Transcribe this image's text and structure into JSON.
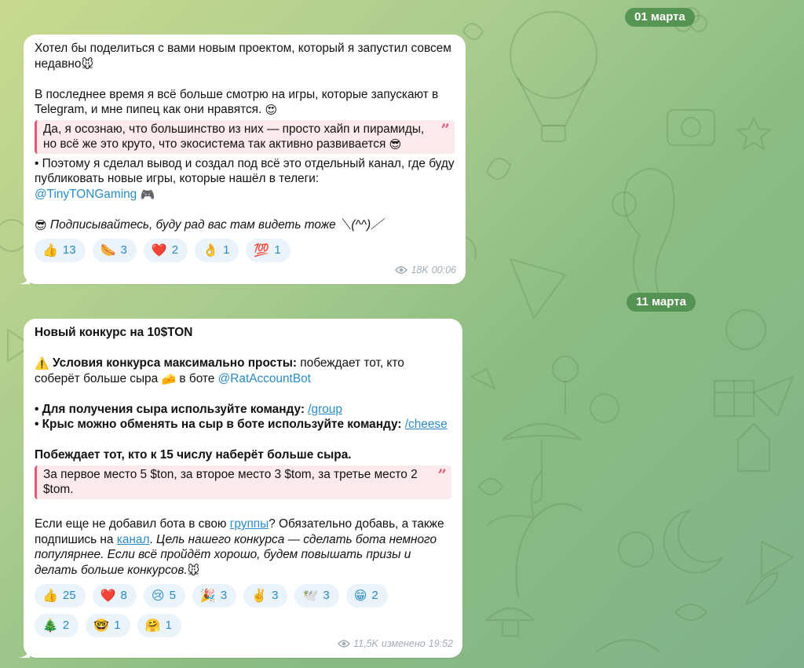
{
  "dates": [
    "01 марта",
    "11 марта"
  ],
  "post1": {
    "p1": "Хотел бы поделиться с вами новым проектом, который я запустил совсем недавно",
    "p1_emoji": "🐭",
    "p2": "В последнее время я всё больше смотрю на игры, которые запускают в Telegram, и мне пипец как они нравятся.",
    "p2_emoji": "😍",
    "quote": "Да, я осознаю, что большинство из них — просто хайп и пирамиды, но всё же это круто, что экосистема так активно развивается",
    "quote_emoji": "😎",
    "quote_mark": "”",
    "p3": "• Поэтому я сделал вывод и создал под всё это отдельный канал, где буду публиковать новые игры, которые нашёл в телеги:",
    "channel_link": "@TinyTONGaming",
    "channel_emoji": "🎮",
    "closing_emoji": "😎",
    "closing": "Подписывайтесь, буду рад вас там видеть тоже ＼(^^)／",
    "reactions": [
      {
        "emoji": "👍",
        "count": "13",
        "icon": "thumbs-up"
      },
      {
        "emoji": "🌭",
        "count": "3",
        "icon": "hotdog"
      },
      {
        "emoji": "❤️",
        "count": "2",
        "icon": "heart"
      },
      {
        "emoji": "👌",
        "count": "1",
        "icon": "ok-hand"
      },
      {
        "emoji": "💯",
        "count": "1",
        "icon": "hundred"
      }
    ],
    "views": "18K",
    "time": "00:06"
  },
  "post2": {
    "title": "Новый конкурс на 10$TON",
    "warn_emoji": "⚠️",
    "conditions_bold": "Условия конкурса максимально просты:",
    "conditions_text": "побеждает тот, кто соберёт больше сыра",
    "cheese_emoji": "🧀",
    "in_bot": "в боте",
    "bot_link": "@RatAccountBot",
    "rule1_bold": "• Для получения сыра используйте команду:",
    "rule1_cmd": "/group",
    "rule2_bold": "• Крыс можно обменять на сыр в боте используйте команду:",
    "rule2_cmd": "/cheese",
    "winner_bold": "Побеждает тот, кто к 15 числу наберёт больше сыра.",
    "prizes_quote": "За первое место 5 $ton, за второе место 3 $tom, за третье место 2 $tom.",
    "quote_mark": "”",
    "p_end_1": "Если еще не добавил бота в свою",
    "groups_link": "группы",
    "p_end_2": "? Обязательно добавь, а также подпишись на",
    "channel_link": "канал",
    "p_end_3": ".",
    "italic_tail": "Цель нашего конкурса — сделать бота немного популярнее. Если всё пройдёт хорошо, будем повышать призы и делать больше конкурсов.",
    "end_emoji": "🐭",
    "reactions": [
      {
        "emoji": "👍",
        "count": "25",
        "icon": "thumbs-up"
      },
      {
        "emoji": "❤️",
        "count": "8",
        "icon": "heart"
      },
      {
        "emoji": "😢",
        "count": "5",
        "icon": "crying-face"
      },
      {
        "emoji": "🎉",
        "count": "3",
        "icon": "party-popper"
      },
      {
        "emoji": "✌️",
        "count": "3",
        "icon": "victory-hand"
      },
      {
        "emoji": "🕊️",
        "count": "3",
        "icon": "dove"
      },
      {
        "emoji": "😁",
        "count": "2",
        "icon": "grinning-face"
      },
      {
        "emoji": "🎄",
        "count": "2",
        "icon": "christmas-tree"
      },
      {
        "emoji": "🤓",
        "count": "1",
        "icon": "nerd-face"
      },
      {
        "emoji": "🤗",
        "count": "1",
        "icon": "hugging-face"
      }
    ],
    "views": "11,5K",
    "edited": "изменено",
    "time": "19:52"
  },
  "colors": {
    "link": "#2a8ac8",
    "quote_bar": "#e05a78",
    "quote_bg": "#fbe9ec",
    "reaction_bg": "#eaf2fa",
    "date_pill": "#4a8c4a"
  }
}
